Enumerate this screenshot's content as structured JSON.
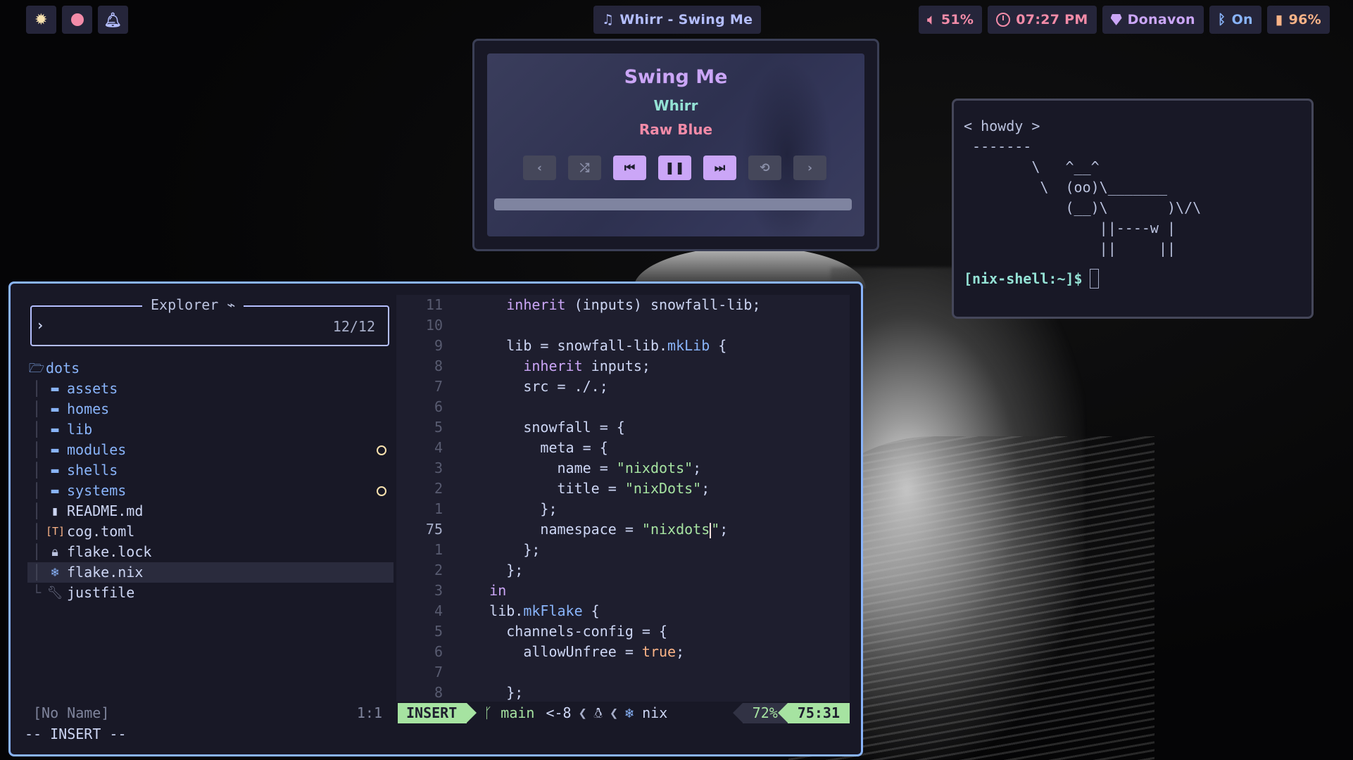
{
  "topbar": {
    "left_icons": [
      "sun-gear-icon",
      "record-icon",
      "bell-icon"
    ],
    "media": "Whirr - Swing Me",
    "volume": "51%",
    "clock": "07:27 PM",
    "user": "Donavon",
    "bluetooth": "On",
    "battery": "96%"
  },
  "media_player": {
    "title": "Swing Me",
    "artist": "Whirr",
    "album": "Raw Blue",
    "controls": [
      "prev-page",
      "shuffle",
      "previous",
      "pause",
      "next",
      "repeat",
      "next-page"
    ],
    "progress": 0.0
  },
  "cowsay": {
    "art": "< howdy >\n -------\n        \\   ^__^\n         \\  (oo)\\_______\n            (__)\\       )\\/\\\n                ||----w |\n                ||     ||",
    "prompt": "[nix-shell:~]$"
  },
  "explorer": {
    "title": "Explorer",
    "count": "12/12",
    "root": "dots",
    "items": [
      {
        "name": "assets",
        "type": "folder",
        "dirty": false
      },
      {
        "name": "homes",
        "type": "folder",
        "dirty": false
      },
      {
        "name": "lib",
        "type": "folder",
        "dirty": false
      },
      {
        "name": "modules",
        "type": "folder",
        "dirty": true
      },
      {
        "name": "shells",
        "type": "folder",
        "dirty": false
      },
      {
        "name": "systems",
        "type": "folder",
        "dirty": true
      },
      {
        "name": "README.md",
        "type": "markdown",
        "dirty": false
      },
      {
        "name": "cog.toml",
        "type": "toml",
        "dirty": false
      },
      {
        "name": "flake.lock",
        "type": "lock",
        "dirty": false
      },
      {
        "name": "flake.nix",
        "type": "nix",
        "dirty": false
      },
      {
        "name": "justfile",
        "type": "just",
        "dirty": false
      }
    ],
    "status_name": "[No Name]",
    "status_pos": "1:1"
  },
  "code": {
    "line_numbers": [
      "11",
      "10",
      "9",
      "8",
      "7",
      "6",
      "5",
      "4",
      "3",
      "2",
      "1",
      "75",
      "1",
      "2",
      "3",
      "4",
      "5",
      "6",
      "7",
      "8"
    ],
    "lines": [
      "      inherit (inputs) snowfall-lib;",
      "",
      "      lib = snowfall-lib.mkLib {",
      "        inherit inputs;",
      "        src = ./.;",
      "",
      "        snowfall = {",
      "          meta = {",
      "            name = \"nixdots\";",
      "            title = \"nixDots\";",
      "          };",
      "          namespace = \"nixdots\";",
      "        };",
      "      };",
      "    in",
      "    lib.mkFlake {",
      "      channels-config = {",
      "        allowUnfree = true;",
      "",
      "      };"
    ]
  },
  "statusline": {
    "mode": "INSERT",
    "branch": "main",
    "diff": "<-8",
    "filetype": "nix",
    "percent": "72%",
    "position": "75:31"
  },
  "cmdline": "-- INSERT --"
}
